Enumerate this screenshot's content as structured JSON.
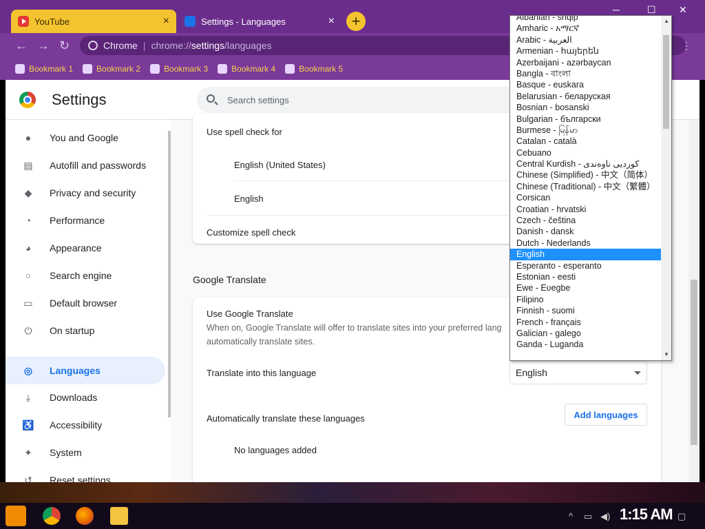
{
  "tabs": [
    {
      "title": "YouTube"
    },
    {
      "title": "Settings - Languages"
    }
  ],
  "omnibox": {
    "site": "Chrome",
    "url_scheme": "chrome://",
    "url_host": "settings",
    "url_path": "/languages"
  },
  "bookmarks": [
    {
      "label": "Bookmark 1"
    },
    {
      "label": "Bookmark 2"
    },
    {
      "label": "Bookmark 3"
    },
    {
      "label": "Bookmark 4"
    },
    {
      "label": "Bookmark 5"
    }
  ],
  "header": {
    "title": "Settings",
    "search_placeholder": "Search settings"
  },
  "sidebar": {
    "items": [
      {
        "label": "You and Google",
        "icon": "person-icon"
      },
      {
        "label": "Autofill and passwords",
        "icon": "clipboard-icon"
      },
      {
        "label": "Privacy and security",
        "icon": "shield-icon"
      },
      {
        "label": "Performance",
        "icon": "speedometer-icon"
      },
      {
        "label": "Appearance",
        "icon": "palette-icon"
      },
      {
        "label": "Search engine",
        "icon": "search-icon"
      },
      {
        "label": "Default browser",
        "icon": "browser-icon"
      },
      {
        "label": "On startup",
        "icon": "power-icon"
      },
      {
        "label": "Languages",
        "icon": "globe-icon"
      },
      {
        "label": "Downloads",
        "icon": "download-icon"
      },
      {
        "label": "Accessibility",
        "icon": "accessibility-icon"
      },
      {
        "label": "System",
        "icon": "wrench-icon"
      },
      {
        "label": "Reset settings",
        "icon": "reset-icon"
      }
    ]
  },
  "spell_check": {
    "heading": "Use spell check for",
    "languages": [
      "English (United States)",
      "English"
    ],
    "customize": "Customize spell check"
  },
  "translate": {
    "section_title": "Google Translate",
    "toggle_label": "Use Google Translate",
    "description": "When on, Google Translate will offer to translate sites into your preferred lang",
    "description_2": "automatically translate sites.",
    "target_label": "Translate into this language",
    "target_value": "English",
    "auto_label": "Automatically translate these languages",
    "add_button": "Add languages",
    "empty_text": "No languages added"
  },
  "dropdown": {
    "options": [
      "Albanian - shqip",
      "Amharic - አማርኛ",
      "Arabic - العربية",
      "Armenian - հայերեն",
      "Azerbaijani - azərbaycan",
      "Bangla - বাংলা",
      "Basque - euskara",
      "Belarusian - беларуская",
      "Bosnian - bosanski",
      "Bulgarian - български",
      "Burmese - မြန်မာ",
      "Catalan - català",
      "Cebuano",
      "Central Kurdish - کوردیی ناوەندی",
      "Chinese (Simplified) - 中文（简体）",
      "Chinese (Traditional) - 中文（繁體）",
      "Corsican",
      "Croatian - hrvatski",
      "Czech - čeština",
      "Danish - dansk",
      "Dutch - Nederlands",
      "English",
      "Esperanto - esperanto",
      "Estonian - eesti",
      "Ewe - Eʋegbe",
      "Filipino",
      "Finnish - suomi",
      "French - français",
      "Galician - galego",
      "Ganda - Luganda"
    ],
    "selected": "English"
  },
  "taskbar": {
    "clock": "1:15 AM"
  },
  "colors": {
    "tab_strip": "#6b2d8c",
    "active_tab": "#f4c430",
    "accent": "#1a73e8",
    "selection": "#1e90ff"
  }
}
